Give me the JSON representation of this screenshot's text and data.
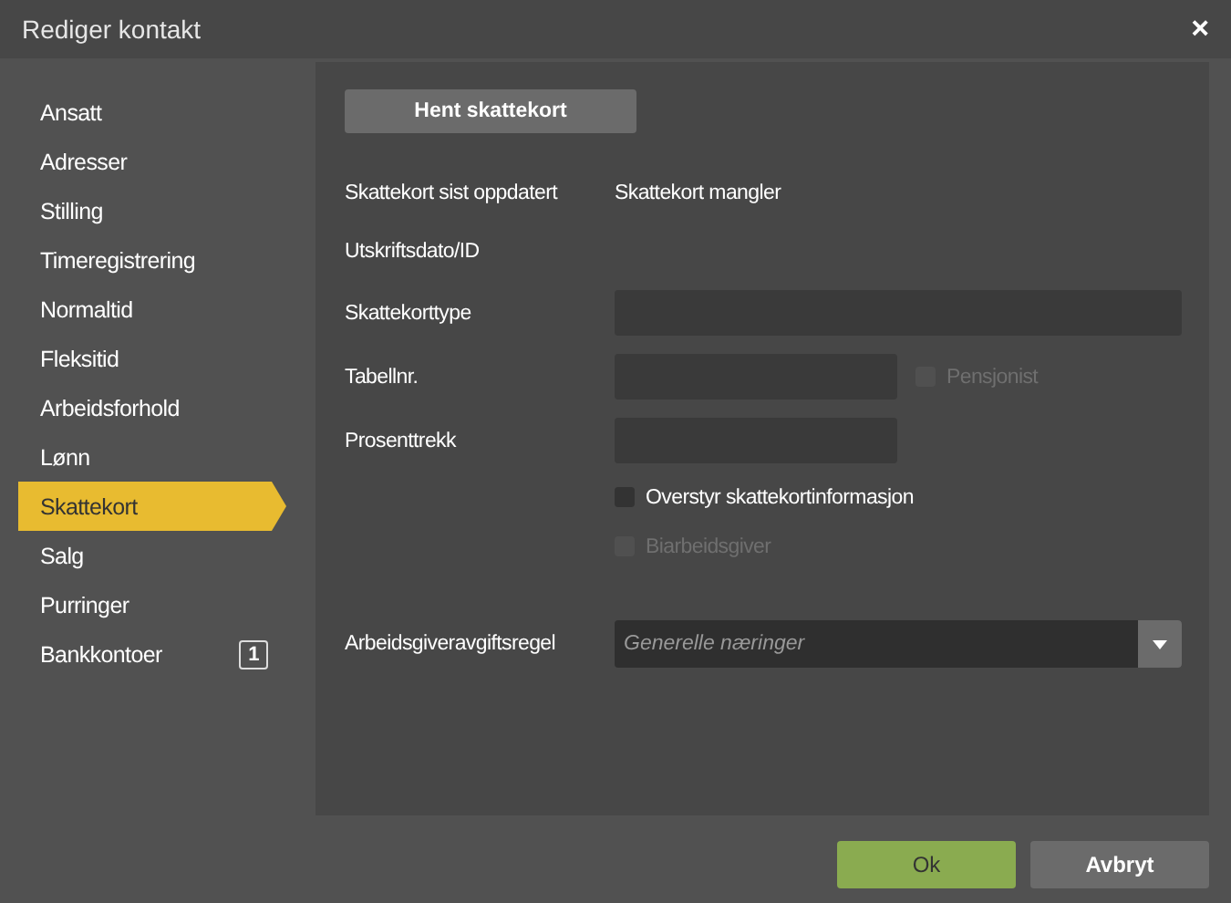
{
  "window": {
    "title": "Rediger kontakt",
    "close": "×"
  },
  "nav": [
    {
      "label": "Ansatt",
      "selected": false
    },
    {
      "label": "Adresser",
      "selected": false
    },
    {
      "label": "Stilling",
      "selected": false
    },
    {
      "label": "Timeregistrering",
      "selected": false
    },
    {
      "label": "Normaltid",
      "selected": false
    },
    {
      "label": "Fleksitid",
      "selected": false
    },
    {
      "label": "Arbeidsforhold",
      "selected": false
    },
    {
      "label": "Lønn",
      "selected": false
    },
    {
      "label": "Skattekort",
      "selected": true
    },
    {
      "label": "Salg",
      "selected": false
    },
    {
      "label": "Purringer",
      "selected": false
    },
    {
      "label": "Bankkontoer",
      "selected": false,
      "badge": "1"
    }
  ],
  "fetch_button": "Hent skattekort",
  "rows": [
    {
      "kind": "text",
      "label": "Skattekort sist oppdatert",
      "value": "Skattekort mangler"
    },
    {
      "kind": "text",
      "label": "Utskriftsdato/ID"
    },
    {
      "kind": "wide_input",
      "label": "Skattekorttype"
    },
    {
      "kind": "input",
      "label": "Tabellnr.",
      "checkbox": {
        "label": "Pensjonist",
        "checked": false,
        "disabled": true
      }
    },
    {
      "kind": "input",
      "label": "Prosenttrekk"
    },
    {
      "kind": "checkbox",
      "label": "Overstyr skattekortinformasjon",
      "checked": false,
      "disabled": false
    },
    {
      "kind": "checkbox",
      "label": "Biarbeidsgiver",
      "checked": false,
      "disabled": true
    },
    {
      "kind": "select",
      "label": "Arbeidsgiveravgiftsregel",
      "placeholder": "Generelle næringer"
    }
  ],
  "buttons": [
    {
      "label": "Ok",
      "kind": "primary"
    },
    {
      "label": "Avbryt",
      "kind": "secondary"
    }
  ]
}
